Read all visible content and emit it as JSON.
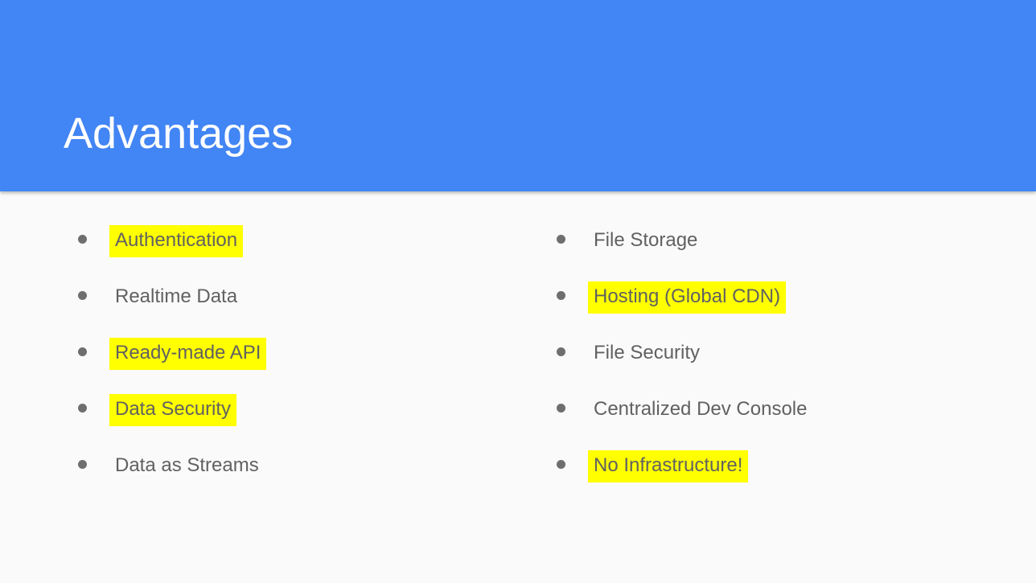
{
  "slide": {
    "title": "Advantages",
    "colors": {
      "header": "#4285f4",
      "highlight": "#ffff00",
      "text": "#616161",
      "background": "#fafafa"
    },
    "left_column": [
      {
        "label": "Authentication",
        "highlighted": true
      },
      {
        "label": "Realtime Data",
        "highlighted": false
      },
      {
        "label": "Ready-made API",
        "highlighted": true
      },
      {
        "label": "Data Security",
        "highlighted": true
      },
      {
        "label": "Data as Streams",
        "highlighted": false
      }
    ],
    "right_column": [
      {
        "label": "File Storage",
        "highlighted": false
      },
      {
        "label": "Hosting (Global CDN)",
        "highlighted": true
      },
      {
        "label": "File Security",
        "highlighted": false
      },
      {
        "label": "Centralized Dev Console",
        "highlighted": false
      },
      {
        "label": "No Infrastructure!",
        "highlighted": true
      }
    ]
  }
}
